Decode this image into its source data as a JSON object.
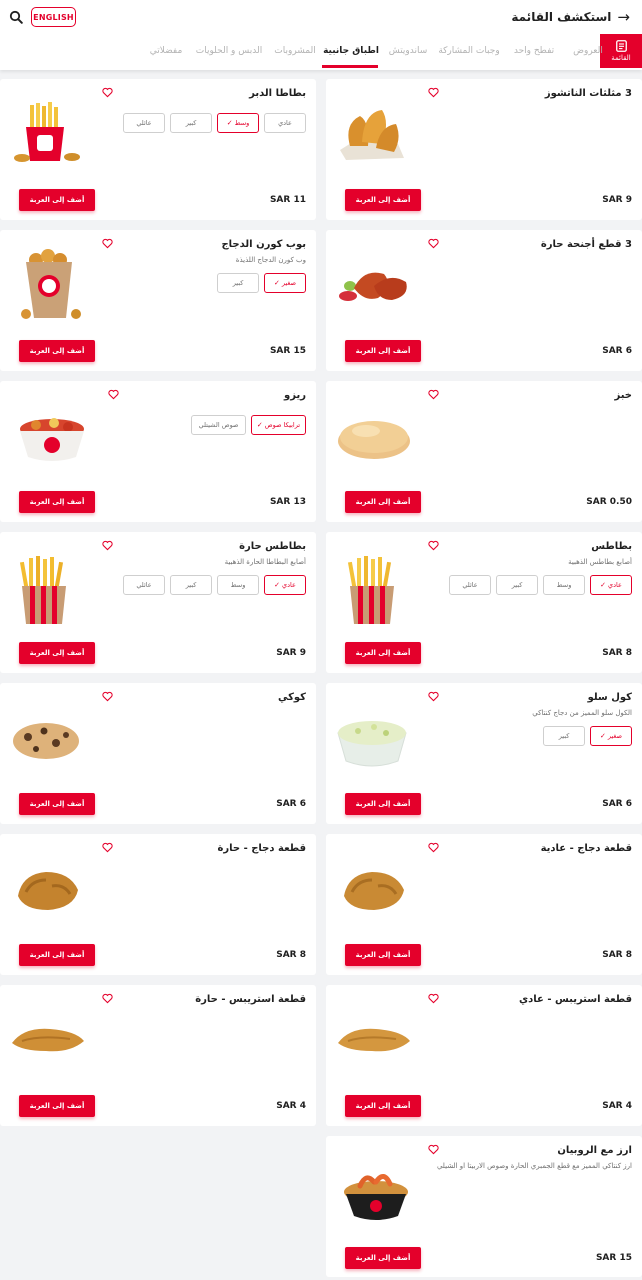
{
  "header": {
    "title": "استكشف القائمة",
    "language_button": "ENGLISH",
    "menu_tab_label": "القائمة"
  },
  "tabs": [
    {
      "label": "العروض",
      "active": false
    },
    {
      "label": "تفطح واحد",
      "active": false
    },
    {
      "label": "وجبات المشاركة",
      "active": false
    },
    {
      "label": "ساندويتش",
      "active": false
    },
    {
      "label": "اطباق جانبية",
      "active": true
    },
    {
      "label": "المشروبات",
      "active": false
    },
    {
      "label": "الدبس و الحلويات",
      "active": false
    },
    {
      "label": "مفضلاتي",
      "active": false
    }
  ],
  "add_to_cart_label": "أضف إلى العربة",
  "colors": {
    "accent": "#e4002b",
    "background": "#f2f3f5"
  },
  "products": [
    {
      "name": "3 مثلثات الناتشوز",
      "price": "SAR 9",
      "image": "nachos-triangles"
    },
    {
      "name": "بطاطا الدبر",
      "price": "SAR 11",
      "image": "fries-bucket-with-nuggets",
      "options": [
        {
          "label": "عادي",
          "selected": false
        },
        {
          "label": "وسط",
          "selected": true
        },
        {
          "label": "كبير",
          "selected": false
        },
        {
          "label": "عائلي",
          "selected": false
        }
      ]
    },
    {
      "name": "3 قطع أجنحة حارة",
      "price": "SAR 6",
      "image": "spicy-wings"
    },
    {
      "name": "بوب كورن الدجاج",
      "description": "وب كورن الدجاج اللذيذة",
      "price": "SAR 15",
      "image": "popcorn-chicken-box",
      "options": [
        {
          "label": "صغير",
          "selected": true
        },
        {
          "label": "كبير",
          "selected": false
        }
      ]
    },
    {
      "name": "خبز",
      "price": "SAR 0.50",
      "image": "bread-bun"
    },
    {
      "name": "ريزو",
      "price": "SAR 13",
      "image": "rizo-bowl",
      "options": [
        {
          "label": "ترابيكا صوص",
          "selected": true
        },
        {
          "label": "صوص الشيتلي",
          "selected": false
        }
      ]
    },
    {
      "name": "بطاطس",
      "description": "أصابع بطاطس الذهبية",
      "price": "SAR 8",
      "image": "french-fries",
      "options": [
        {
          "label": "عادي",
          "selected": true
        },
        {
          "label": "وسط",
          "selected": false
        },
        {
          "label": "كبير",
          "selected": false
        },
        {
          "label": "عائلي",
          "selected": false
        }
      ]
    },
    {
      "name": "بطاطس حارة",
      "description": "أصابع البطاطا الحارة الذهبية",
      "price": "SAR 9",
      "image": "spicy-fries",
      "options": [
        {
          "label": "عادي",
          "selected": true
        },
        {
          "label": "وسط",
          "selected": false
        },
        {
          "label": "كبير",
          "selected": false
        },
        {
          "label": "عائلي",
          "selected": false
        }
      ]
    },
    {
      "name": "كول سلو",
      "description": "الكول سلو المميز من دجاج كنتاكي",
      "price": "SAR 6",
      "image": "coleslaw-bowl",
      "options": [
        {
          "label": "صغير",
          "selected": true
        },
        {
          "label": "كبير",
          "selected": false
        }
      ]
    },
    {
      "name": "كوكي",
      "price": "SAR 6",
      "image": "cookie"
    },
    {
      "name": "قطعة دجاج - عادية",
      "price": "SAR 8",
      "image": "fried-chicken-piece"
    },
    {
      "name": "قطعة دجاج - حارة",
      "price": "SAR 8",
      "image": "fried-chicken-piece-spicy"
    },
    {
      "name": "قطعة استريبس - عادي",
      "price": "SAR 4",
      "image": "chicken-strip"
    },
    {
      "name": "قطعة استريبس - حارة",
      "price": "SAR 4",
      "image": "chicken-strip-spicy"
    },
    {
      "name": "ارز مع الروبيان",
      "description": "ارز كنتاكي المميز مع قطع الجمبري الحارة وصوص الاربيتا او الشيلي",
      "price": "SAR 15",
      "image": "rice-with-shrimp"
    }
  ]
}
